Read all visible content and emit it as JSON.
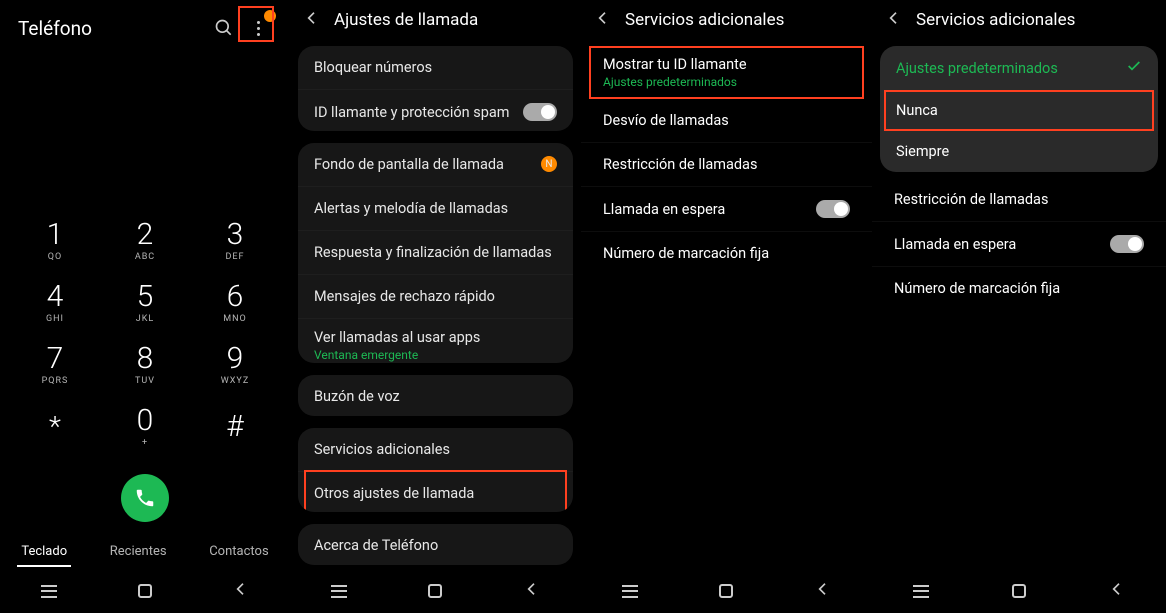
{
  "screen1": {
    "title": "Teléfono",
    "keypad": [
      [
        {
          "n": "1",
          "s": "QO"
        },
        {
          "n": "2",
          "s": "ABC"
        },
        {
          "n": "3",
          "s": "DEF"
        }
      ],
      [
        {
          "n": "4",
          "s": "GHI"
        },
        {
          "n": "5",
          "s": "JKL"
        },
        {
          "n": "6",
          "s": "MNO"
        }
      ],
      [
        {
          "n": "7",
          "s": "PQRS"
        },
        {
          "n": "8",
          "s": "TUV"
        },
        {
          "n": "9",
          "s": "WXYZ"
        }
      ],
      [
        {
          "n": "*",
          "s": ""
        },
        {
          "n": "0",
          "s": "+"
        },
        {
          "n": "#",
          "s": ""
        }
      ]
    ],
    "tabs": {
      "keypad": "Teclado",
      "recent": "Recientes",
      "contacts": "Contactos"
    }
  },
  "screen2": {
    "title": "Ajustes de llamada",
    "rows": {
      "block": "Bloquear números",
      "caller_id": "ID llamante y protección spam",
      "wallpaper": "Fondo de pantalla de llamada",
      "alerts": "Alertas y melodía de llamadas",
      "answer": "Respuesta y finalización de llamadas",
      "reject": "Mensajes de rechazo rápido",
      "apps": "Ver llamadas al usar apps",
      "apps_sub": "Ventana emergente",
      "voicemail": "Buzón de voz",
      "additional": "Servicios adicionales",
      "other": "Otros ajustes de llamada",
      "about": "Acerca de Teléfono"
    }
  },
  "screen3": {
    "title": "Servicios adicionales",
    "rows": {
      "show_id": "Mostrar tu ID llamante",
      "show_id_sub": "Ajustes predeterminados",
      "forward": "Desvío de llamadas",
      "restrict": "Restricción de llamadas",
      "waiting": "Llamada en espera",
      "fixed": "Número de marcación fija"
    }
  },
  "screen4": {
    "title": "Servicios adicionales",
    "dropdown": {
      "default": "Ajustes predeterminados",
      "never": "Nunca",
      "always": "Siempre"
    },
    "rows": {
      "restrict": "Restricción de llamadas",
      "waiting": "Llamada en espera",
      "fixed": "Número de marcación fija"
    }
  }
}
